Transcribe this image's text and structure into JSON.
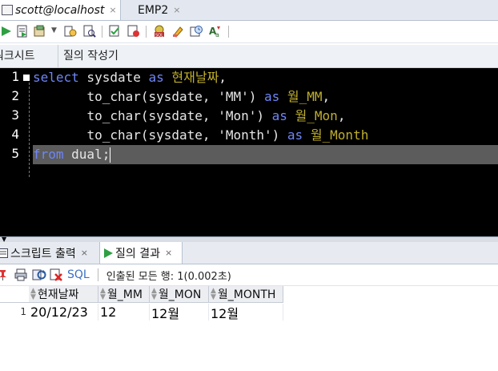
{
  "tabs": [
    {
      "label": "scott@localhost",
      "close": "×"
    },
    {
      "label": "EMP2",
      "close": "×"
    }
  ],
  "toolbar_icons": [
    "run-statement-icon",
    "run-script-icon",
    "commit-icon",
    "rollback-icon",
    "explain-plan-icon",
    "autotrace-icon",
    "sql-tuning-icon",
    "clear-icon",
    "history-icon",
    "format-icon",
    "uppercase-icon"
  ],
  "sub_tabs": [
    "워크시트",
    "질의 작성기"
  ],
  "editor": {
    "line_numbers": [
      "1",
      "2",
      "3",
      "4",
      "5"
    ],
    "lines": [
      {
        "kw1": "select",
        "t1": " sysdate ",
        "kw2": "as",
        "t2": " ",
        "alias": "현재날짜",
        "t3": ","
      },
      {
        "indent": "       ",
        "t1": "to_char(sysdate, ",
        "str": "'MM'",
        "t2": ") ",
        "kw": "as",
        "t3": " ",
        "alias": "월_MM",
        "t4": ","
      },
      {
        "indent": "       ",
        "t1": "to_char(sysdate, ",
        "str": "'Mon'",
        "t2": ") ",
        "kw": "as",
        "t3": " ",
        "alias": "월_Mon",
        "t4": ","
      },
      {
        "indent": "       ",
        "t1": "to_char(sysdate, ",
        "str": "'Month'",
        "t2": ") ",
        "kw": "as",
        "t3": " ",
        "alias": "월_Month",
        "t4": ""
      },
      {
        "kw": "from",
        "t1": " dual;"
      }
    ]
  },
  "output_tabs": [
    {
      "label": "스크립트 출력",
      "close": "×"
    },
    {
      "label": "질의 결과",
      "close": "×"
    }
  ],
  "result_toolbar": {
    "sql_label": "SQL",
    "status": "인출된 모든 행: 1(0.002초)"
  },
  "results": {
    "columns": [
      "현재날짜",
      "월_MM",
      "월_MON",
      "월_MONTH"
    ],
    "rows": [
      {
        "num": "1",
        "cells": [
          "20/12/23",
          "12",
          "12월",
          "12월"
        ]
      }
    ]
  },
  "colors": {
    "editor_bg": "#000000",
    "keyword": "#6f86f7",
    "alias": "#bfae2e",
    "current_line": "#5c5c5c",
    "link": "#3b6fc4"
  }
}
